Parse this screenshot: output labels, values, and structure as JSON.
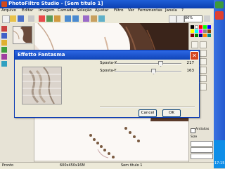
{
  "window": {
    "title": "PhotoFiltre Studio - [Sem título 1]"
  },
  "menu": [
    "Arquivo",
    "Editar",
    "Imagem",
    "Camada",
    "Seleção",
    "Ajustar",
    "Filtro",
    "Ver",
    "Ferramentas",
    "Janela",
    "?"
  ],
  "toolbar": {
    "zoom_value": "86%"
  },
  "dialog": {
    "title": "Effetto Fantasma",
    "spostax_label": "Sposta-X",
    "spostax_value": "217",
    "spostay_label": "Sposta-Y",
    "spostay_value": "163",
    "cancel_label": "Cancel",
    "ok_label": "OK"
  },
  "rightpanel": {
    "antialias_label": "Antialias",
    "size_label": "Size"
  },
  "status": {
    "ready": "Pronto",
    "dimensions": "600x450x16M",
    "doc": "Sem título 1"
  },
  "taskbar": {
    "clock": "17:15"
  },
  "colors": {
    "titlebar": "#1f5fd8",
    "accent": "#0a3bb5",
    "close": "#d6451f"
  }
}
